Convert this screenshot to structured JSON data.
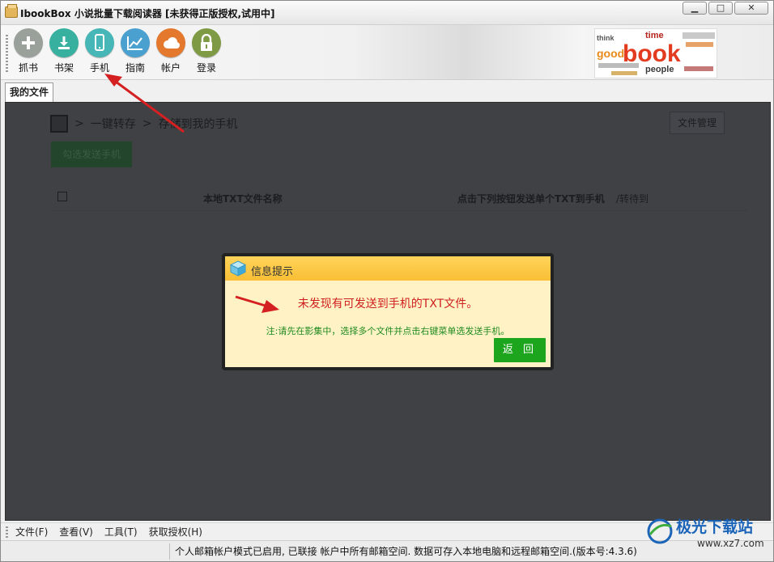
{
  "window": {
    "title": "IbookBox 小说批量下载阅读器 [未获得正版授权,试用中]",
    "controls": {
      "minimize": "▁",
      "maximize": "□",
      "close": "✕"
    }
  },
  "toolbar": {
    "items": [
      {
        "label": "抓书",
        "icon": "plus-icon",
        "color": "#9aa09a"
      },
      {
        "label": "书架",
        "icon": "download-icon",
        "color": "#37b0a0"
      },
      {
        "label": "手机",
        "icon": "phone-icon",
        "color": "#47b6b6"
      },
      {
        "label": "指南",
        "icon": "chart-icon",
        "color": "#4aa0cf"
      },
      {
        "label": "帐户",
        "icon": "cloud-icon",
        "color": "#e4782d"
      },
      {
        "label": "登录",
        "icon": "lock-icon",
        "color": "#7f9a44"
      }
    ]
  },
  "logo": {
    "big": "book",
    "word_good": "good",
    "word_people": "people",
    "word_time": "time",
    "word_think": "think"
  },
  "tab": {
    "label": "我的文件"
  },
  "content": {
    "breadcrumb": [
      ">",
      "一键转存",
      ">",
      "存储到我的手机"
    ],
    "file_manage": "文件管理",
    "send_button": "勾选发送手机",
    "table": {
      "col_name": "本地TXT文件名称",
      "col_action": "点击下列按钮发送单个TXT到手机",
      "col_extra": "/转待到"
    }
  },
  "dialog": {
    "title": "信息提示",
    "message": "未发现有可发送到手机的TXT文件。",
    "note": "注:请先在影集中，选择多个文件并点击右键菜单选发送手机。",
    "button": "返 回"
  },
  "menu": {
    "items": [
      "文件(F)",
      "查看(V)",
      "工具(T)",
      "获取授权(H)"
    ]
  },
  "status": {
    "text": "个人邮箱帐户模式已启用, 已联接 帐户中所有邮箱空间. 数据可存入本地电脑和远程邮箱空间.(版本号:4.3.6)"
  },
  "watermark": {
    "name": "极光下载站",
    "url": "www.xz7.com"
  },
  "colors": {
    "dialog_header": "#f9be35",
    "dialog_bg": "#fff3c6",
    "return_button": "#1ea51e",
    "arrow": "#d42020"
  }
}
